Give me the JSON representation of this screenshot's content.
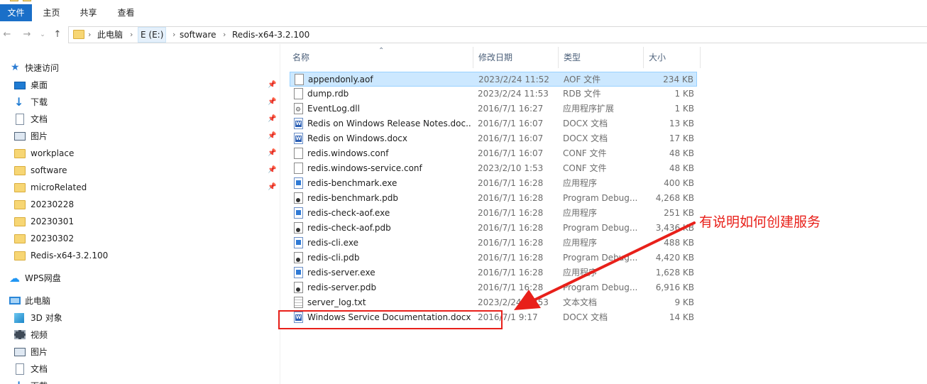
{
  "ribbon": {
    "tabs": [
      "文件",
      "主页",
      "共享",
      "查看"
    ]
  },
  "address": {
    "crumbs": [
      "此电脑",
      "E (E:)",
      "software",
      "Redis-x64-3.2.100"
    ]
  },
  "nav": {
    "quick_access": "快速访问",
    "items": [
      {
        "label": "桌面",
        "icon": "desktop-icon",
        "pinned": true
      },
      {
        "label": "下载",
        "icon": "download-icon",
        "pinned": true
      },
      {
        "label": "文档",
        "icon": "document-icon",
        "pinned": true
      },
      {
        "label": "图片",
        "icon": "picture-icon",
        "pinned": true
      },
      {
        "label": "workplace",
        "icon": "folder-icon",
        "pinned": true
      },
      {
        "label": "software",
        "icon": "folder-icon",
        "pinned": true
      },
      {
        "label": "microRelated",
        "icon": "folder-icon",
        "pinned": true
      },
      {
        "label": "20230228",
        "icon": "folder-icon",
        "pinned": false
      },
      {
        "label": "20230301",
        "icon": "folder-icon",
        "pinned": false
      },
      {
        "label": "20230302",
        "icon": "folder-icon",
        "pinned": false
      },
      {
        "label": "Redis-x64-3.2.100",
        "icon": "folder-icon",
        "pinned": false
      }
    ],
    "wps": "WPS网盘",
    "this_pc": "此电脑",
    "pc_items": [
      {
        "label": "3D 对象",
        "icon": "3d-objects-icon"
      },
      {
        "label": "视频",
        "icon": "video-icon"
      },
      {
        "label": "图片",
        "icon": "picture-icon"
      },
      {
        "label": "文档",
        "icon": "document-icon"
      },
      {
        "label": "下载",
        "icon": "download-icon"
      }
    ]
  },
  "list": {
    "columns": {
      "name": "名称",
      "date": "修改日期",
      "type": "类型",
      "size": "大小"
    },
    "files": [
      {
        "name": "appendonly.aof",
        "date": "2023/2/24 11:52",
        "type": "AOF 文件",
        "size": "234 KB",
        "icon": "generic-file-icon",
        "selected": true
      },
      {
        "name": "dump.rdb",
        "date": "2023/2/24 11:53",
        "type": "RDB 文件",
        "size": "1 KB",
        "icon": "generic-file-icon"
      },
      {
        "name": "EventLog.dll",
        "date": "2016/7/1 16:27",
        "type": "应用程序扩展",
        "size": "1 KB",
        "icon": "dll-file-icon"
      },
      {
        "name": "Redis on Windows Release Notes.doc...",
        "date": "2016/7/1 16:07",
        "type": "DOCX 文档",
        "size": "13 KB",
        "icon": "word-file-icon"
      },
      {
        "name": "Redis on Windows.docx",
        "date": "2016/7/1 16:07",
        "type": "DOCX 文档",
        "size": "17 KB",
        "icon": "word-file-icon"
      },
      {
        "name": "redis.windows.conf",
        "date": "2016/7/1 16:07",
        "type": "CONF 文件",
        "size": "48 KB",
        "icon": "generic-file-icon"
      },
      {
        "name": "redis.windows-service.conf",
        "date": "2023/2/10 1:53",
        "type": "CONF 文件",
        "size": "48 KB",
        "icon": "generic-file-icon"
      },
      {
        "name": "redis-benchmark.exe",
        "date": "2016/7/1 16:28",
        "type": "应用程序",
        "size": "400 KB",
        "icon": "exe-file-icon"
      },
      {
        "name": "redis-benchmark.pdb",
        "date": "2016/7/1 16:28",
        "type": "Program Debug...",
        "size": "4,268 KB",
        "icon": "pdb-file-icon"
      },
      {
        "name": "redis-check-aof.exe",
        "date": "2016/7/1 16:28",
        "type": "应用程序",
        "size": "251 KB",
        "icon": "exe-file-icon"
      },
      {
        "name": "redis-check-aof.pdb",
        "date": "2016/7/1 16:28",
        "type": "Program Debug...",
        "size": "3,436 KB",
        "icon": "pdb-file-icon"
      },
      {
        "name": "redis-cli.exe",
        "date": "2016/7/1 16:28",
        "type": "应用程序",
        "size": "488 KB",
        "icon": "exe-file-icon"
      },
      {
        "name": "redis-cli.pdb",
        "date": "2016/7/1 16:28",
        "type": "Program Debug...",
        "size": "4,420 KB",
        "icon": "pdb-file-icon"
      },
      {
        "name": "redis-server.exe",
        "date": "2016/7/1 16:28",
        "type": "应用程序",
        "size": "1,628 KB",
        "icon": "exe-file-icon"
      },
      {
        "name": "redis-server.pdb",
        "date": "2016/7/1 16:28",
        "type": "Program Debug...",
        "size": "6,916 KB",
        "icon": "pdb-file-icon"
      },
      {
        "name": "server_log.txt",
        "date": "2023/2/24 11:53",
        "type": "文本文档",
        "size": "9 KB",
        "icon": "text-file-icon"
      },
      {
        "name": "Windows Service Documentation.docx",
        "date": "2016/7/1 9:17",
        "type": "DOCX 文档",
        "size": "14 KB",
        "icon": "word-file-icon"
      }
    ]
  },
  "annotation": {
    "text": "有说明如何创建服务",
    "color": "#e8201a"
  },
  "colors": {
    "accent": "#1a6fc8",
    "selection": "#cce8ff"
  }
}
